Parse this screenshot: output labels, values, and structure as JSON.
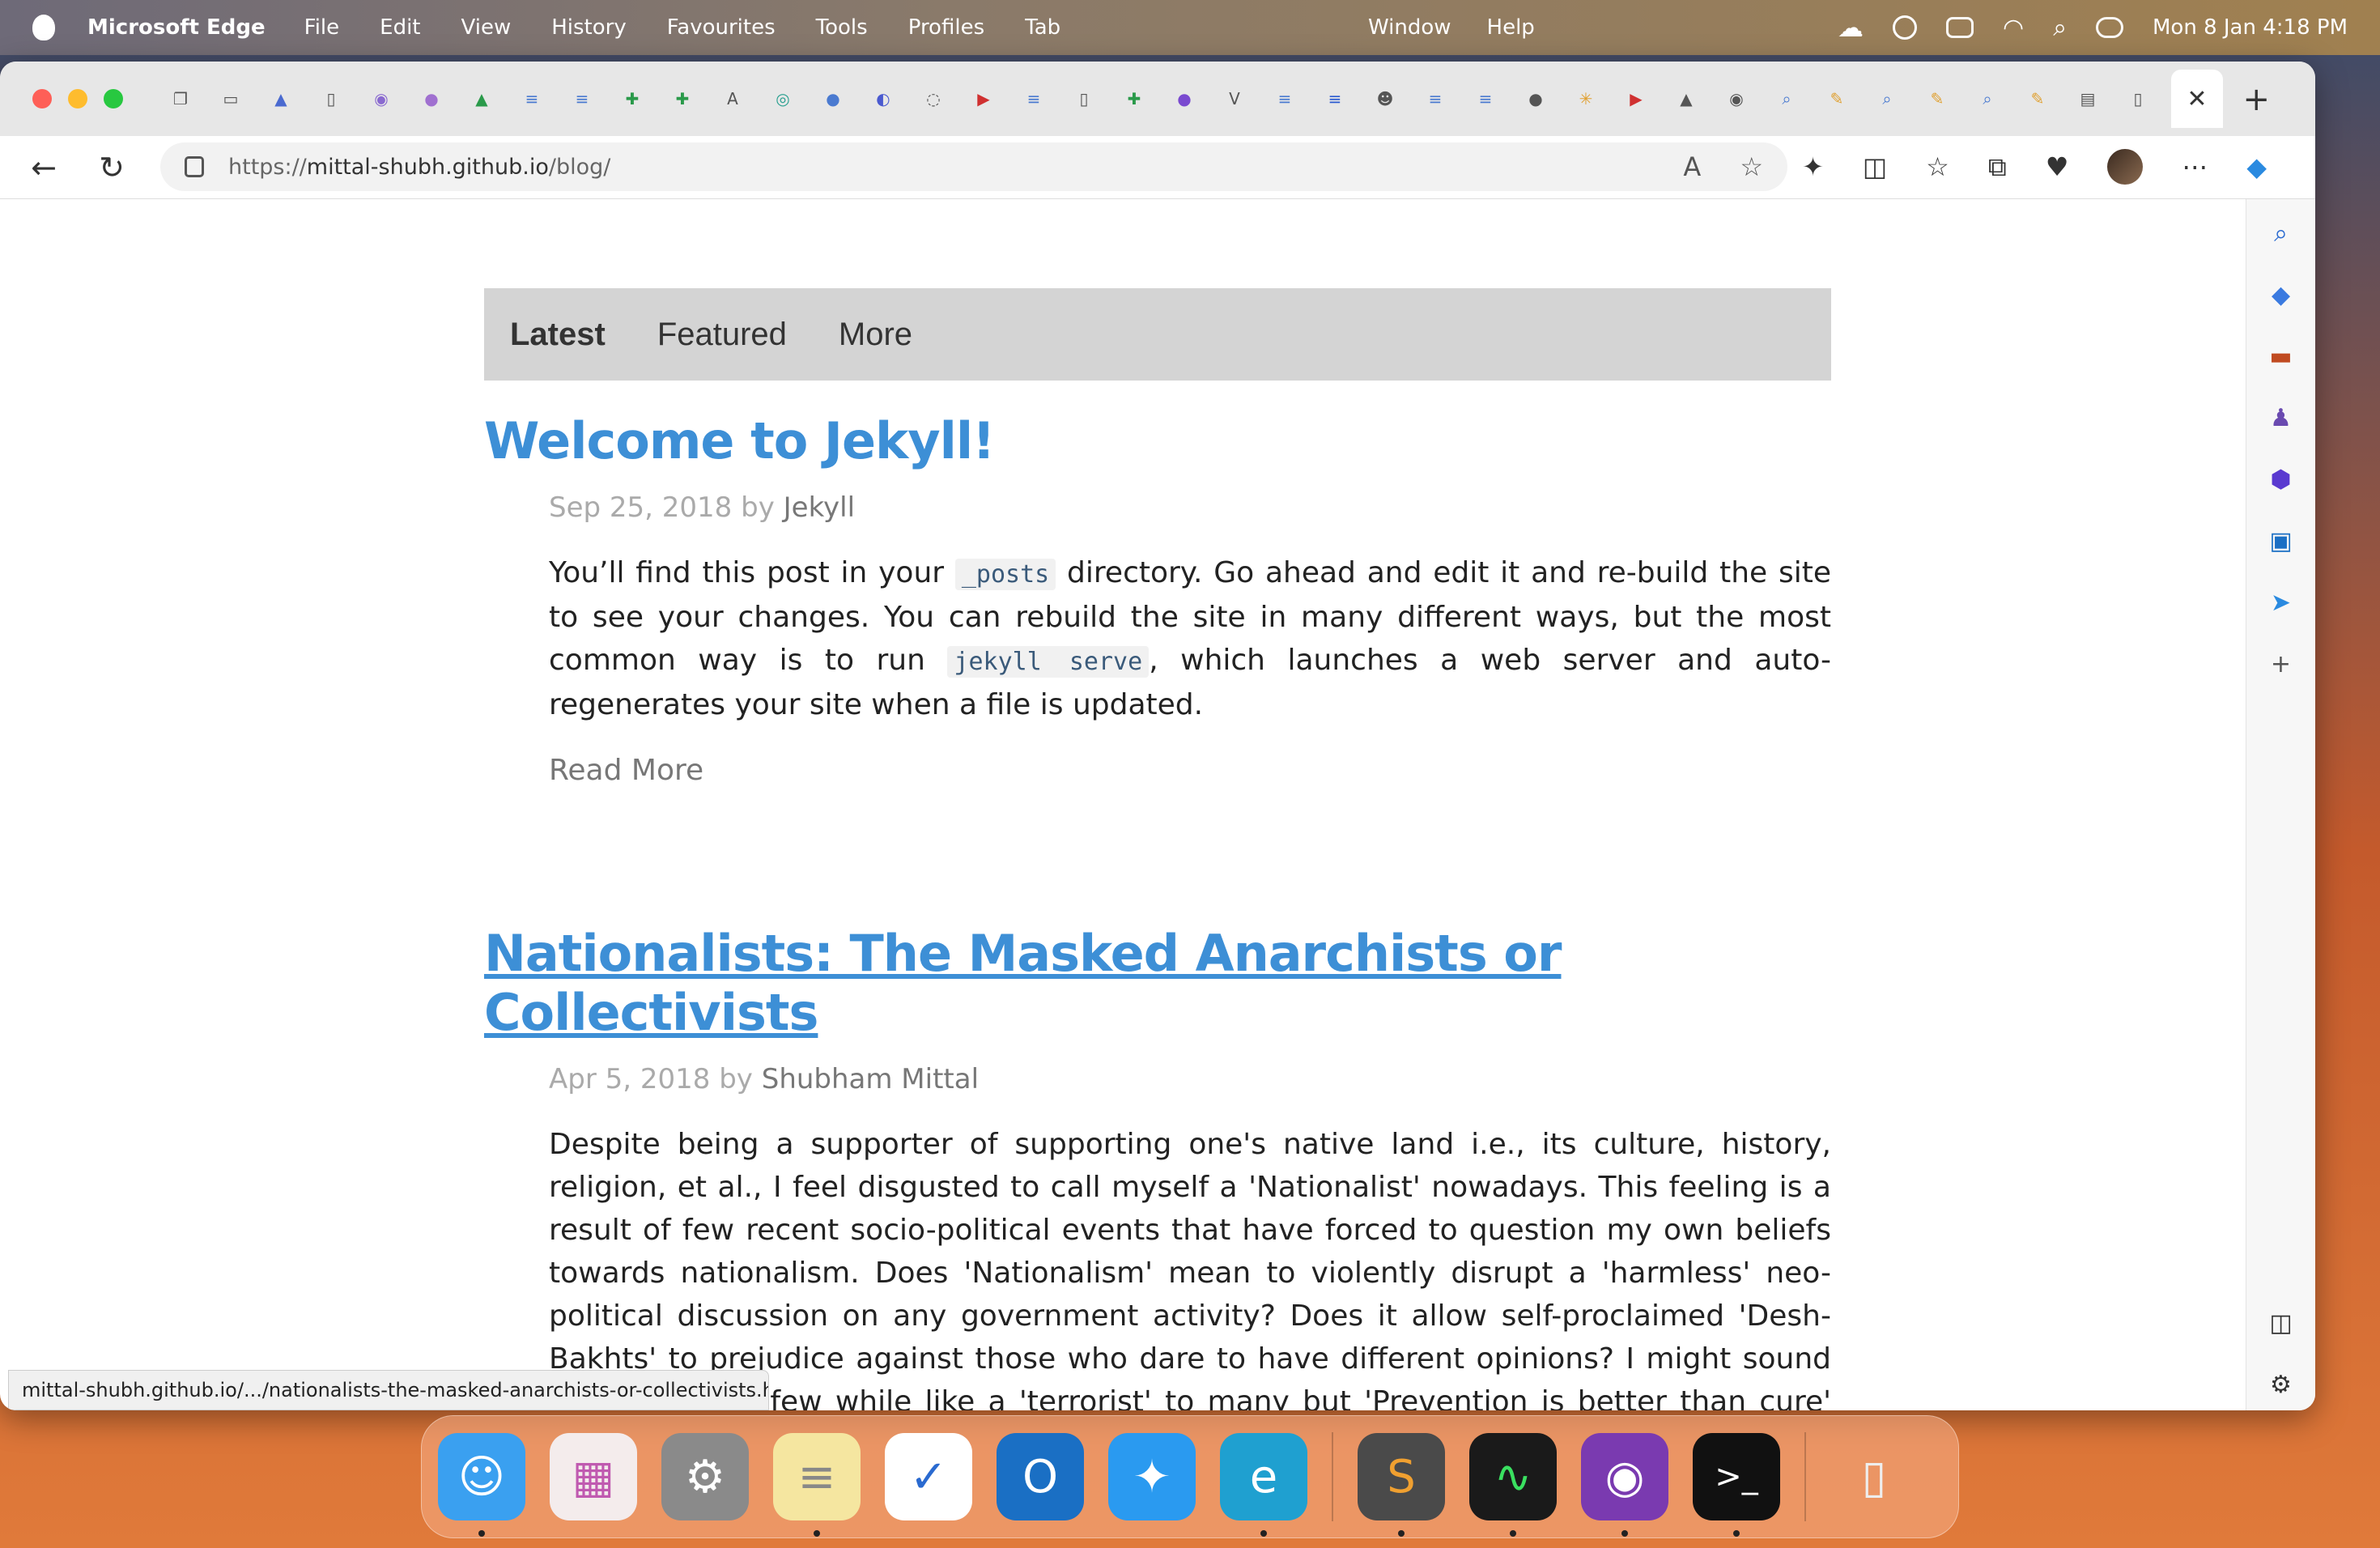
{
  "menubar": {
    "app": "Microsoft Edge",
    "items": [
      "File",
      "Edit",
      "View",
      "History",
      "Favourites",
      "Tools",
      "Profiles",
      "Tab"
    ],
    "center_items": [
      "Window",
      "Help"
    ],
    "datetime": "Mon 8 Jan  4:18 PM"
  },
  "browser": {
    "url_scheme": "https://",
    "url_host": "mittal-shubh.github.io",
    "url_path": "/blog/",
    "status_url": "mittal-shubh.github.io/.../nationalists-the-masked-anarchists-or-collectivists.ht..."
  },
  "blog": {
    "nav": [
      "Latest",
      "Featured",
      "More"
    ],
    "posts": [
      {
        "title": "Welcome to Jekyll!",
        "date": "Sep 25, 2018",
        "by": "by",
        "author": "Jekyll",
        "body_1": "You’ll find this post in your ",
        "code_1": "_posts",
        "body_2": " directory. Go ahead and edit it and re-build the site to see your changes. You can rebuild the site in many different ways, but the most common way is to run ",
        "code_2": "jekyll serve",
        "body_3": ", which launches a web server and auto-regenerates your site when a file is updated.",
        "read_more": "Read More"
      },
      {
        "title": "Nationalists: The Masked Anarchists or Collectivists",
        "date": "Apr 5, 2018",
        "by": "by",
        "author": "Shubham Mittal",
        "body": "Despite being a supporter of supporting one's native land i.e., its culture, history, religion, et al., I feel disgusted to call myself a 'Nationalist' nowadays. This feeling is a result of few recent socio-political events that have forced to question my own beliefs towards nationalism. Does 'Nationalism' mean to violently disrupt a 'harmless' neo-political discussion on any government activity? Does it allow self-proclaimed 'Desh-Bakhts' to prejudice against those who dare to have different opinions? I might sound full of rage to few while like a 'terrorist' to many but 'Prevention is better than cure' don't imply to completely cut your 'possibly' infected body parts. Rather, this aphorism teaches us to take preliminary precautions before any serious problem (Being wild once is enough for any country) might arise which can, at last, only be cured. And, should not, in any way, be similar to \"genocide\". For those who like transparent"
      }
    ]
  },
  "dock": {
    "apps": [
      {
        "name": "finder",
        "color": "#3aa0f0",
        "glyph": "☺"
      },
      {
        "name": "launchpad",
        "color": "#f0e8e8",
        "glyph": "▦"
      },
      {
        "name": "system-settings",
        "color": "#8a8a8a",
        "glyph": "⚙"
      },
      {
        "name": "notes",
        "color": "#f5e6a0",
        "glyph": "≡"
      },
      {
        "name": "todo",
        "color": "#ffffff",
        "glyph": "✓"
      },
      {
        "name": "outlook",
        "color": "#1a6fc4",
        "glyph": "O"
      },
      {
        "name": "safari",
        "color": "#2a9af0",
        "glyph": "✦"
      },
      {
        "name": "edge",
        "color": "#1fa0d0",
        "glyph": "e"
      },
      {
        "name": "sublime-text",
        "color": "#4a4a4a",
        "glyph": "S"
      },
      {
        "name": "activity-monitor",
        "color": "#1a1a1a",
        "glyph": "∿"
      },
      {
        "name": "github-desktop",
        "color": "#7a3ab0",
        "glyph": "◉"
      },
      {
        "name": "terminal",
        "color": "#111111",
        "glyph": ">_"
      },
      {
        "name": "trash",
        "color": "#e8e8e8",
        "glyph": "🗑"
      }
    ]
  }
}
